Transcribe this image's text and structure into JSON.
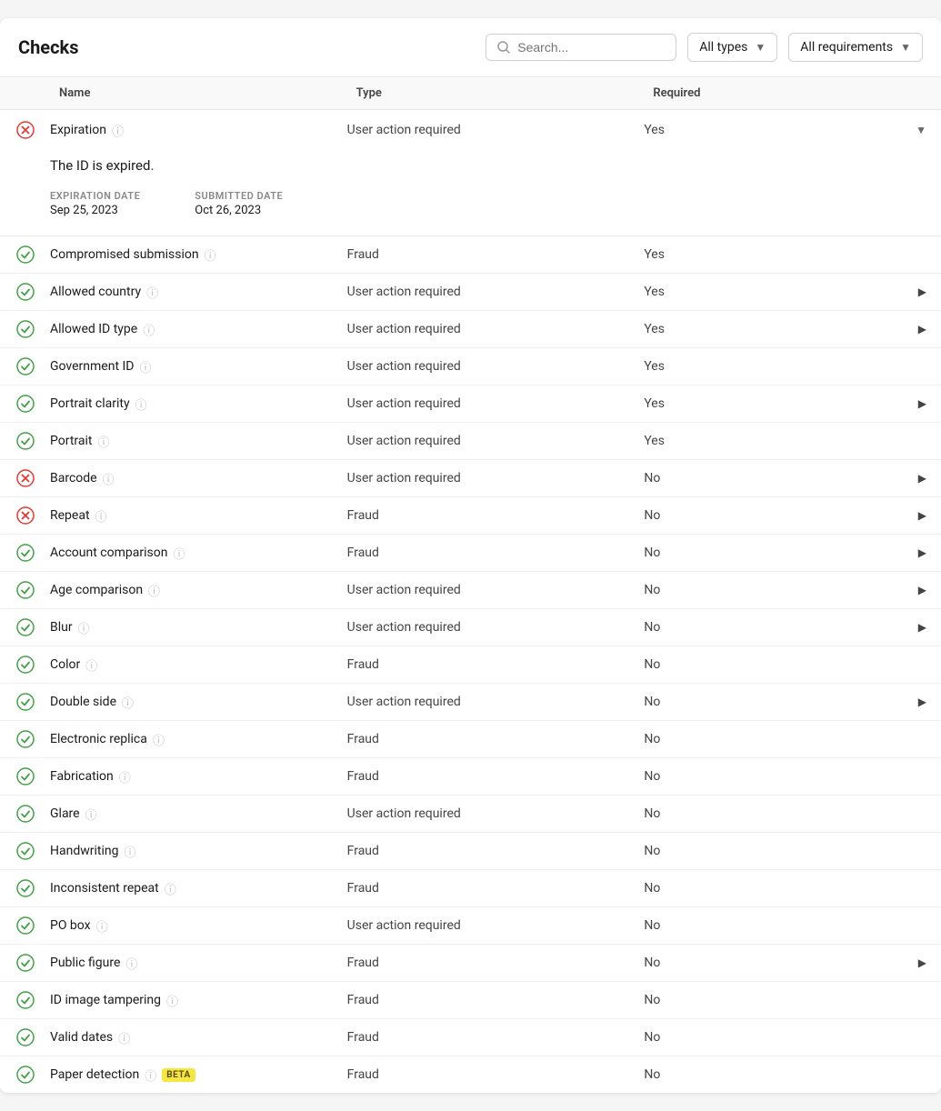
{
  "header": {
    "title": "Checks",
    "search_placeholder": "Search...",
    "type_filter": "All types",
    "requirements_filter": "All requirements"
  },
  "table": {
    "columns": [
      "",
      "Name",
      "Type",
      "Required"
    ],
    "expanded_row": {
      "name": "Expiration",
      "type": "User action required",
      "required": "Yes",
      "detail_text": "The ID is expired.",
      "expiration_label": "EXPIRATION DATE",
      "expiration_value": "Sep 25, 2023",
      "submitted_label": "SUBMITTED DATE",
      "submitted_value": "Oct 26, 2023"
    },
    "rows": [
      {
        "status": "pass",
        "name": "Compromised submission",
        "has_info": true,
        "type": "Fraud",
        "required": "Yes",
        "has_expand": false
      },
      {
        "status": "pass",
        "name": "Allowed country",
        "has_info": true,
        "type": "User action required",
        "required": "Yes",
        "has_expand": true
      },
      {
        "status": "pass",
        "name": "Allowed ID type",
        "has_info": true,
        "type": "User action required",
        "required": "Yes",
        "has_expand": true
      },
      {
        "status": "pass",
        "name": "Government ID",
        "has_info": true,
        "type": "User action required",
        "required": "Yes",
        "has_expand": false
      },
      {
        "status": "pass",
        "name": "Portrait clarity",
        "has_info": true,
        "type": "User action required",
        "required": "Yes",
        "has_expand": true
      },
      {
        "status": "pass",
        "name": "Portrait",
        "has_info": true,
        "type": "User action required",
        "required": "Yes",
        "has_expand": false
      },
      {
        "status": "fail",
        "name": "Barcode",
        "has_info": true,
        "type": "User action required",
        "required": "No",
        "has_expand": true
      },
      {
        "status": "fail",
        "name": "Repeat",
        "has_info": true,
        "type": "Fraud",
        "required": "No",
        "has_expand": true
      },
      {
        "status": "pass",
        "name": "Account comparison",
        "has_info": true,
        "type": "Fraud",
        "required": "No",
        "has_expand": true
      },
      {
        "status": "pass",
        "name": "Age comparison",
        "has_info": true,
        "type": "User action required",
        "required": "No",
        "has_expand": true
      },
      {
        "status": "pass",
        "name": "Blur",
        "has_info": true,
        "type": "User action required",
        "required": "No",
        "has_expand": true
      },
      {
        "status": "pass",
        "name": "Color",
        "has_info": true,
        "type": "Fraud",
        "required": "No",
        "has_expand": false
      },
      {
        "status": "pass",
        "name": "Double side",
        "has_info": true,
        "type": "User action required",
        "required": "No",
        "has_expand": true
      },
      {
        "status": "pass",
        "name": "Electronic replica",
        "has_info": true,
        "type": "Fraud",
        "required": "No",
        "has_expand": false
      },
      {
        "status": "pass",
        "name": "Fabrication",
        "has_info": true,
        "type": "Fraud",
        "required": "No",
        "has_expand": false
      },
      {
        "status": "pass",
        "name": "Glare",
        "has_info": true,
        "type": "User action required",
        "required": "No",
        "has_expand": false
      },
      {
        "status": "pass",
        "name": "Handwriting",
        "has_info": true,
        "type": "Fraud",
        "required": "No",
        "has_expand": false
      },
      {
        "status": "pass",
        "name": "Inconsistent repeat",
        "has_info": true,
        "type": "Fraud",
        "required": "No",
        "has_expand": false
      },
      {
        "status": "pass",
        "name": "PO box",
        "has_info": true,
        "type": "User action required",
        "required": "No",
        "has_expand": false
      },
      {
        "status": "pass",
        "name": "Public figure",
        "has_info": true,
        "type": "Fraud",
        "required": "No",
        "has_expand": true
      },
      {
        "status": "pass",
        "name": "ID image tampering",
        "has_info": true,
        "type": "Fraud",
        "required": "No",
        "has_expand": false
      },
      {
        "status": "pass",
        "name": "Valid dates",
        "has_info": true,
        "type": "Fraud",
        "required": "No",
        "has_expand": false
      },
      {
        "status": "pass",
        "name": "Paper detection",
        "has_info": true,
        "has_beta": true,
        "type": "Fraud",
        "required": "No",
        "has_expand": false
      }
    ]
  }
}
